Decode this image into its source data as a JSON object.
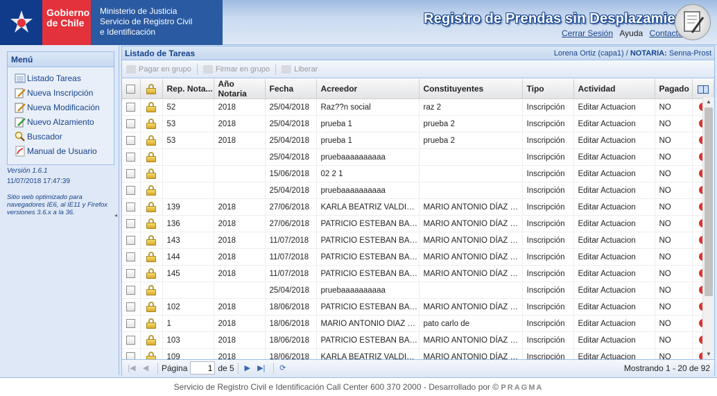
{
  "header": {
    "logo_line1": "Gobierno",
    "logo_line2": "de Chile",
    "ministry_line1": "Ministerio de Justicia",
    "ministry_line2": "Servicio de Registro Civil",
    "ministry_line3": "e Identificación",
    "app_title": "Registro de Prendas sin Desplazamiento",
    "logout_link": "Cerrar Sesión",
    "help_label": "Ayuda",
    "contact_link": "Contacto"
  },
  "sidebar": {
    "menu_title": "Menú",
    "items": [
      {
        "label": "Listado Tareas",
        "icon": "list-icon"
      },
      {
        "label": "Nueva Inscripción",
        "icon": "edit-icon"
      },
      {
        "label": "Nueva Modificación",
        "icon": "edit-icon"
      },
      {
        "label": "Nuevo Alzamiento",
        "icon": "edit-green-icon"
      },
      {
        "label": "Buscador",
        "icon": "search-icon"
      },
      {
        "label": "Manual de Usuario",
        "icon": "pdf-icon"
      }
    ],
    "version": "Versión 1.6.1",
    "datetime": "11/07/2018 17:47:39",
    "browser_note": "Sitio web optimizado para navegadores IE6, al IE11 y Firefox versiones 3.6.x a la 36."
  },
  "main": {
    "title": "Listado de Tareas",
    "user": "Lorena Ortiz (capa1) / ",
    "notaria_label": "NOTARIA:",
    "notaria_value": " Senna-Prost"
  },
  "toolbar": {
    "pay_group": "Pagar en grupo",
    "sign_group": "Firmar en grupo",
    "release": "Liberar"
  },
  "grid": {
    "columns": [
      "Rep. Nota...",
      "Año Notaria",
      "Fecha",
      "Acreedor",
      "Constituyentes",
      "Tipo",
      "Actividad",
      "Pagado"
    ],
    "rows": [
      [
        "52",
        "2018",
        "25/04/2018",
        "Raz??n social",
        "raz 2",
        "Inscripción",
        "Editar Actuacion",
        "NO"
      ],
      [
        "53",
        "2018",
        "25/04/2018",
        "prueba 1",
        "prueba 2",
        "Inscripción",
        "Editar Actuacion",
        "NO"
      ],
      [
        "53",
        "2018",
        "25/04/2018",
        "prueba 1",
        "prueba 2",
        "Inscripción",
        "Editar Actuacion",
        "NO"
      ],
      [
        "",
        "",
        "25/04/2018",
        "pruebaaaaaaaaaa",
        "",
        "Inscripción",
        "Editar Actuacion",
        "NO"
      ],
      [
        "",
        "",
        "15/06/2018",
        "02 2 1",
        "",
        "Inscripción",
        "Editar Actuacion",
        "NO"
      ],
      [
        "",
        "",
        "25/04/2018",
        "pruebaaaaaaaaaa",
        "",
        "Inscripción",
        "Editar Actuacion",
        "NO"
      ],
      [
        "139",
        "2018",
        "27/06/2018",
        "KARLA BEATRIZ VALDIVIA",
        "MARIO ANTONIO DÍAZ DÍAZ",
        "Inscripción",
        "Editar Actuacion",
        "NO"
      ],
      [
        "136",
        "2018",
        "27/06/2018",
        "PATRICIO ESTEBAN BAEZA",
        "MARIO ANTONIO DÍAZ DÍAZ",
        "Inscripción",
        "Editar Actuacion",
        "NO"
      ],
      [
        "143",
        "2018",
        "11/07/2018",
        "PATRICIO ESTEBAN BAEZA",
        "MARIO ANTONIO DÍAZ DÍAZ",
        "Inscripción",
        "Editar Actuacion",
        "NO"
      ],
      [
        "144",
        "2018",
        "11/07/2018",
        "PATRICIO ESTEBAN BAEZA",
        "MARIO ANTONIO DÍAZ DÍAZ",
        "Inscripción",
        "Editar Actuacion",
        "NO"
      ],
      [
        "145",
        "2018",
        "11/07/2018",
        "PATRICIO ESTEBAN BAEZA",
        "MARIO ANTONIO DÍAZ DÍAZ",
        "Inscripción",
        "Editar Actuacion",
        "NO"
      ],
      [
        "",
        "",
        "25/04/2018",
        "pruebaaaaaaaaaa",
        "",
        "Inscripción",
        "Editar Actuacion",
        "NO"
      ],
      [
        "102",
        "2018",
        "18/06/2018",
        "PATRICIO ESTEBAN BAEZA",
        "MARIO ANTONIO DÍAZ DÍAZ",
        "Inscripción",
        "Editar Actuacion",
        "NO"
      ],
      [
        "1",
        "2018",
        "18/06/2018",
        "MARIO ANTONIO DIAZ DIAZ",
        "pato carlo de",
        "Inscripción",
        "Editar Actuacion",
        "NO"
      ],
      [
        "103",
        "2018",
        "18/06/2018",
        "PATRICIO ESTEBAN BAEZA",
        "MARIO ANTONIO DÍAZ DÍAZ",
        "Inscripción",
        "Editar Actuacion",
        "NO"
      ],
      [
        "109",
        "2018",
        "18/06/2018",
        "KARLA BEATRIZ VALDIVIA",
        "MARIO ANTONIO DÍAZ DÍAZ",
        "Inscripción",
        "Editar Actuacion",
        "NO"
      ]
    ]
  },
  "pager": {
    "page_label": "Página",
    "page_value": "1",
    "of_label": "de 5",
    "display_msg": "Mostrando 1 - 20 de 92"
  },
  "footer": {
    "text": "Servicio de Registro Civil e Identificación   Call Center 600 370 2000 - Desarrollado por © ",
    "brand": "PRAGMA"
  }
}
